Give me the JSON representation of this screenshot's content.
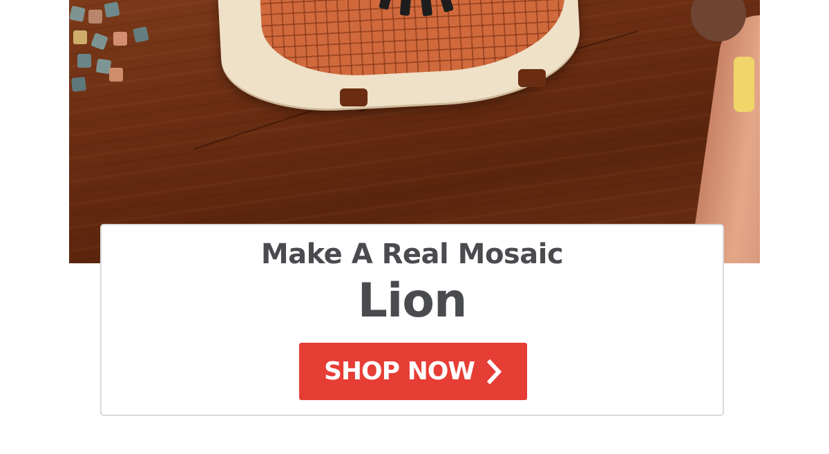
{
  "hero": {
    "icon": "mosaic-lion-photo"
  },
  "card": {
    "subtitle": "Make A Real Mosaic",
    "title": "Lion",
    "button": {
      "label": "SHOP NOW",
      "icon": "chevron-right-icon",
      "color": "#e63d35"
    }
  },
  "colors": {
    "text": "#4a4b4f",
    "card_border": "#d9d9d9",
    "accent": "#e63d35"
  }
}
